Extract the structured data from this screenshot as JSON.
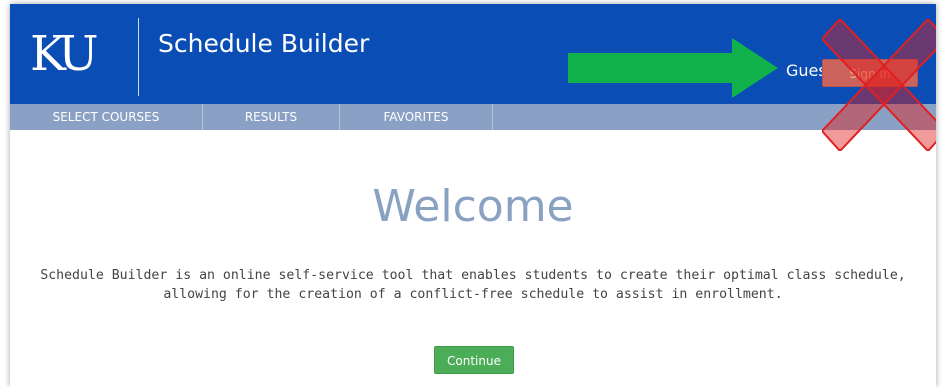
{
  "header": {
    "logo_text": "KU",
    "app_title": "Schedule Builder",
    "user_label": "Guest",
    "sign_in_label": "Sign In"
  },
  "nav": {
    "tabs": [
      {
        "label": "SELECT COURSES"
      },
      {
        "label": "RESULTS"
      },
      {
        "label": "FAVORITES"
      }
    ]
  },
  "main": {
    "heading": "Welcome",
    "intro_line1": "Schedule Builder is an online self-service tool that enables students to create their optimal class schedule,",
    "intro_line2": "allowing for the creation of a conflict-free schedule to assist in enrollment.",
    "continue_label": "Continue"
  },
  "annotations": {
    "arrow_icon": "right-arrow-icon",
    "arrow_color": "#11b14b",
    "cross_icon": "red-x-icon",
    "cross_color": "#e02020"
  },
  "colors": {
    "header_bg": "#0a4db4",
    "nav_bg": "#8aa0c4",
    "welcome_text": "#8aa2c2",
    "continue_bg": "#4cad58",
    "sign_in_bg": "#c9635c"
  }
}
